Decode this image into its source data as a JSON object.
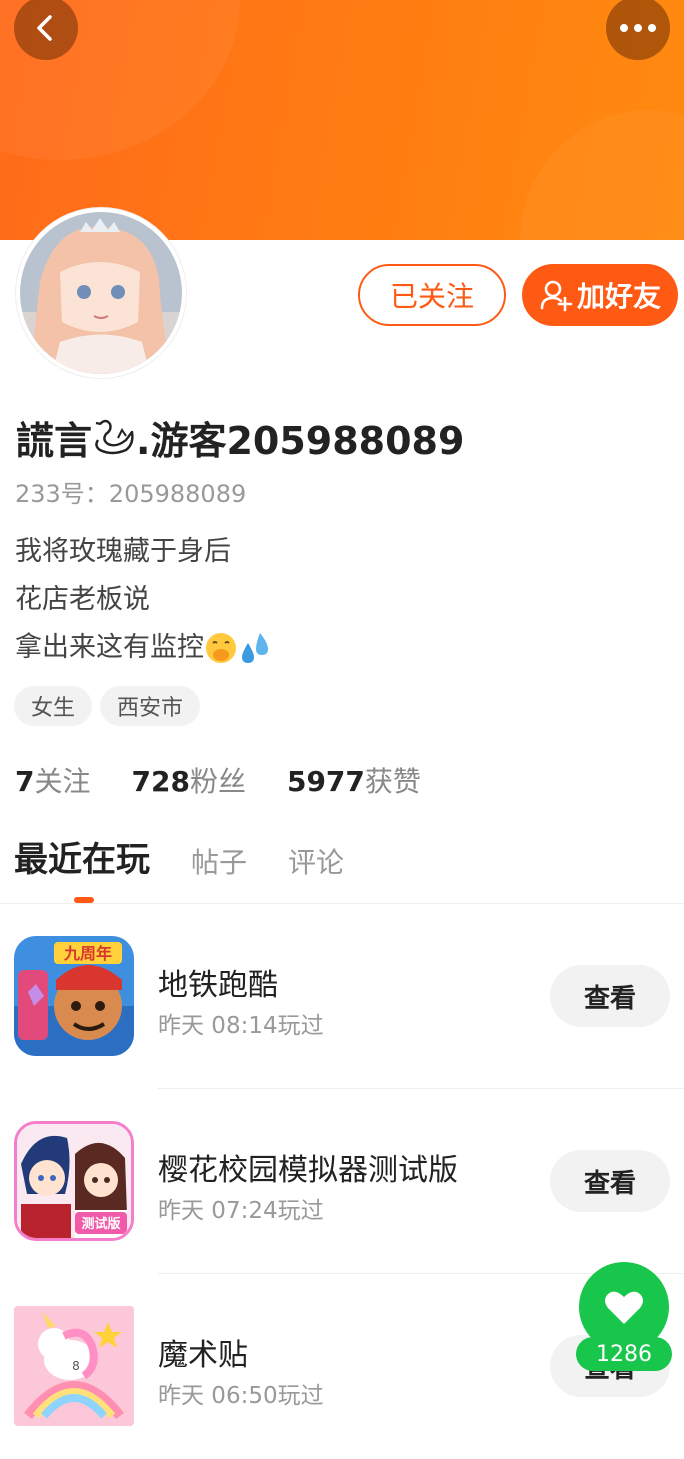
{
  "header": {
    "back_icon": "chevron-left-icon",
    "more_icon": "more-dots-icon"
  },
  "actions": {
    "followed_label": "已关注",
    "add_friend_label": "加好友",
    "add_friend_icon": "add-user-icon",
    "accent": "#ff5a14"
  },
  "profile": {
    "nickname_prefix": "謊言",
    "nickname_suffix": ".游客205988089",
    "account_id": "233号：205988089",
    "bio": [
      "我将玫瑰藏于身后",
      "花店老板说",
      "拿出来这有监控"
    ],
    "tags": [
      "女生",
      "西安市"
    ]
  },
  "stats": [
    {
      "value": "7",
      "label": "关注"
    },
    {
      "value": "728",
      "label": "粉丝"
    },
    {
      "value": "5977",
      "label": "获赞"
    }
  ],
  "tabs": [
    {
      "label": "最近在玩",
      "active": true
    },
    {
      "label": "帖子",
      "active": false
    },
    {
      "label": "评论",
      "active": false
    }
  ],
  "games": [
    {
      "title": "地铁跑酷",
      "played": "昨天 08:14玩过",
      "button": "查看",
      "icon_badge": "九周年"
    },
    {
      "title": "樱花校园模拟器测试版",
      "played": "昨天 07:24玩过",
      "button": "查看",
      "icon_badge": "测试版"
    },
    {
      "title": "魔术贴",
      "played": "昨天 06:50玩过",
      "button": "查看",
      "icon_badge": "8"
    }
  ],
  "like": {
    "count": "1286",
    "icon": "heart-icon",
    "color": "#19c64c"
  }
}
